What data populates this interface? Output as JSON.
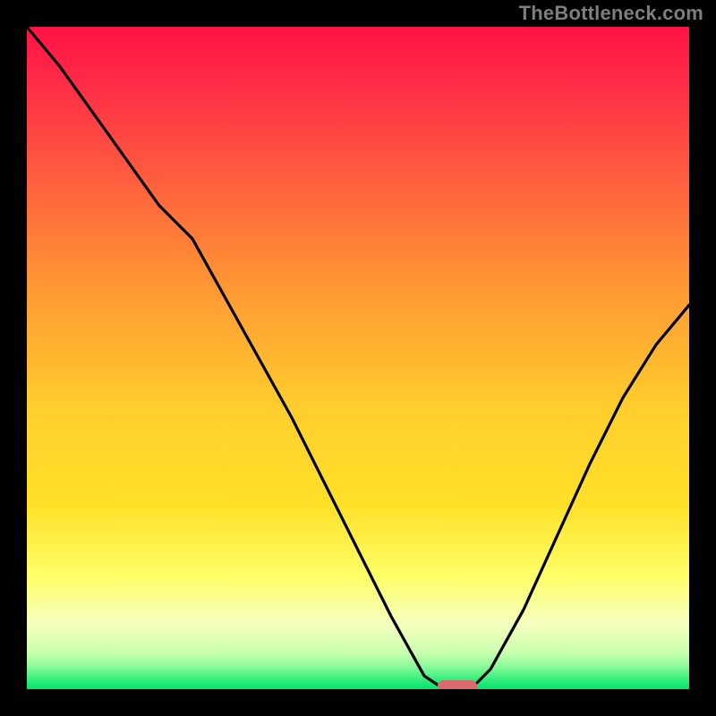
{
  "attribution": "TheBottleneck.com",
  "chart_data": {
    "type": "line",
    "title": "",
    "xlabel": "",
    "ylabel": "",
    "xlim": [
      0,
      100
    ],
    "ylim": [
      0,
      100
    ],
    "grid": false,
    "legend": false,
    "x": [
      0,
      5,
      10,
      15,
      20,
      25,
      30,
      35,
      40,
      45,
      50,
      55,
      60,
      63,
      67,
      70,
      75,
      80,
      85,
      90,
      95,
      100
    ],
    "values": [
      100,
      94,
      87,
      80,
      73,
      68,
      59,
      50,
      41,
      31,
      21,
      11,
      2,
      0,
      0,
      3,
      12,
      23,
      34,
      44,
      52,
      58
    ],
    "sweet_spot": {
      "x_start": 62,
      "x_end": 68,
      "y": 0
    }
  },
  "colors": {
    "gradient_top": "#ff1345",
    "gradient_yellow": "#ffe029",
    "gradient_pale": "#f6ffbe",
    "gradient_bottom": "#00e46b",
    "frame": "#000000",
    "line": "#000000",
    "marker": "#d96a6f"
  }
}
